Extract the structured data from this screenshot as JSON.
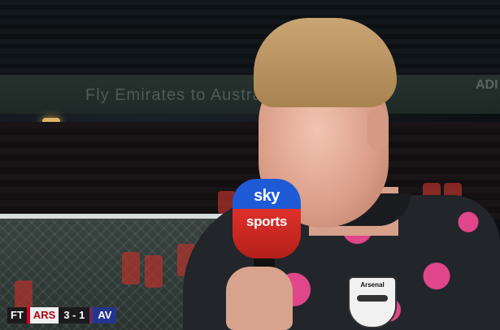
{
  "background": {
    "banner_text": "Fly Emirates to Australia",
    "sponsor_text": "ADI"
  },
  "microphone": {
    "brand_top": "sky",
    "brand_bottom": "sports",
    "colors": {
      "top": "#1f5ad6",
      "bottom": "#e0302a"
    }
  },
  "shirt": {
    "crest_label": "Arsenal"
  },
  "scorebug": {
    "status": "FT",
    "home_team": "ARS",
    "score": "3 - 1",
    "away_team": "AV",
    "colors": {
      "home": "#d8001f",
      "away": "#24358f"
    }
  }
}
